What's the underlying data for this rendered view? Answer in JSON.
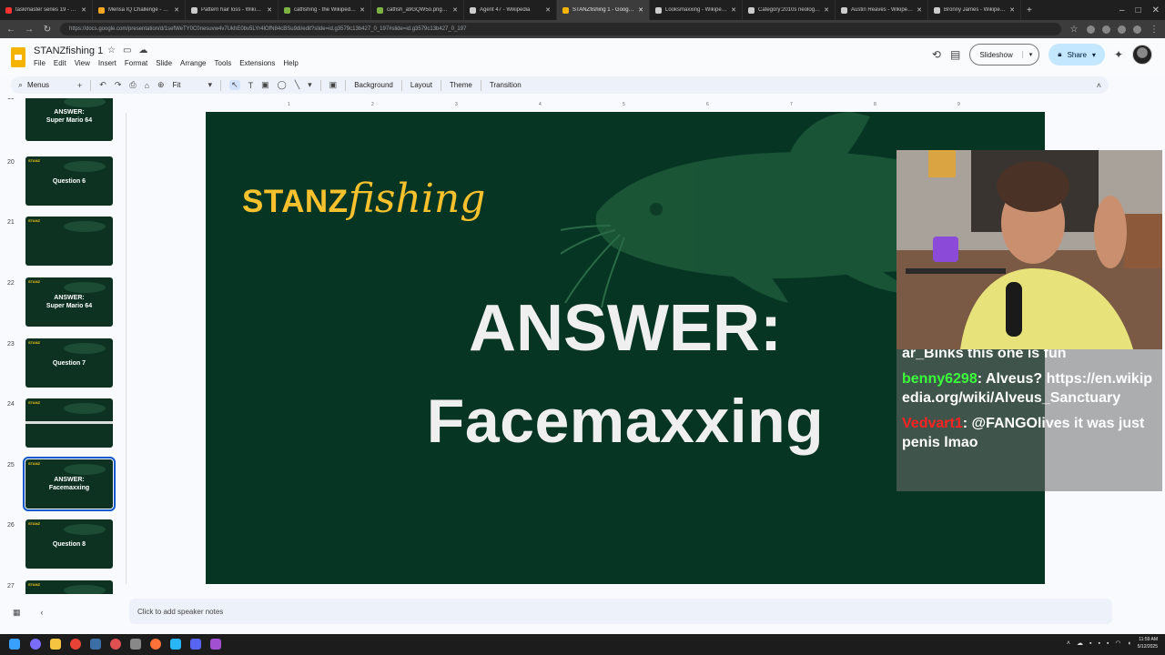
{
  "browser": {
    "tabs": [
      {
        "label": "taskmaster series 19 - YouT",
        "color": "#ff3333"
      },
      {
        "label": "Mensa IQ Challenge - Mens",
        "color": "#f5a623"
      },
      {
        "label": "Pattern hair loss - Wikipedia",
        "color": "#cccccc"
      },
      {
        "label": "catfishing - the Wikipedia g",
        "color": "#7cb342"
      },
      {
        "label": "catfish_a9GQW5o.png (PN",
        "color": "#7cb342"
      },
      {
        "label": "Agent 47 - Wikipedia",
        "color": "#cccccc"
      },
      {
        "label": "STANZfishing 1 - Google Sl",
        "color": "#f4b400",
        "active": true
      },
      {
        "label": "Looksmaxxing - Wikipedia",
        "color": "#cccccc"
      },
      {
        "label": "Category:2010s neologism",
        "color": "#cccccc"
      },
      {
        "label": "Austin Reaves - Wikipedia",
        "color": "#cccccc"
      },
      {
        "label": "Bronny James - Wikipedia",
        "color": "#cccccc"
      }
    ],
    "new_tab": "+",
    "url": "https://docs.google.com/presentation/d/1sefWeTY0C0nesuvw4v7UkhE0bv5LYr4lOfN84cBSu9di/edit?slide=id.g3579c13b427_0_197#slide=id.g3579c13b427_0_197"
  },
  "doc": {
    "title": "STANZfishing 1",
    "menu": [
      "File",
      "Edit",
      "View",
      "Insert",
      "Format",
      "Slide",
      "Arrange",
      "Tools",
      "Extensions",
      "Help"
    ],
    "slideshow_label": "Slideshow",
    "share_label": "Share"
  },
  "toolbar": {
    "menus_label": "Menus",
    "zoom_label": "Fit",
    "background_label": "Background",
    "layout_label": "Layout",
    "theme_label": "Theme",
    "transition_label": "Transition"
  },
  "ruler": [
    "1",
    "2",
    "3",
    "4",
    "5",
    "6",
    "7",
    "8",
    "9"
  ],
  "thumbnails": [
    {
      "num": "19",
      "text": "ANSWER:\nSuper Mario 64"
    },
    {
      "num": "20",
      "text": "Question 6"
    },
    {
      "num": "21",
      "text": ""
    },
    {
      "num": "22",
      "text": "ANSWER:\nSuper Mario 64"
    },
    {
      "num": "23",
      "text": "Question 7"
    },
    {
      "num": "24",
      "text": ""
    },
    {
      "num": "25",
      "text": "ANSWER:\nFacemaxxing",
      "selected": true
    },
    {
      "num": "26",
      "text": "Question 8"
    },
    {
      "num": "27",
      "text": ""
    }
  ],
  "slide": {
    "logo_bold": "STANZ",
    "logo_italic": "fishing",
    "answer_label": "ANSWER:",
    "answer_term": "Facemaxxing",
    "bg_color": "#073523",
    "logo_color": "#f6c12c"
  },
  "chat": [
    {
      "user": "",
      "user_color": "#ffffff",
      "message": "ar_Binks this one is fun"
    },
    {
      "user": "benny6298",
      "user_color": "#3cff3c",
      "message": ": Alveus? https://en.wikipedia.org/wiki/Alveus_Sanctuary"
    },
    {
      "user": "Vedvart1",
      "user_color": "#ff2222",
      "message": ": @FANGOlives it was just penis lmao"
    }
  ],
  "notes_placeholder": "Click to add speaker notes",
  "taskbar": {
    "time": "11:59 AM",
    "date": "5/12/2025"
  }
}
